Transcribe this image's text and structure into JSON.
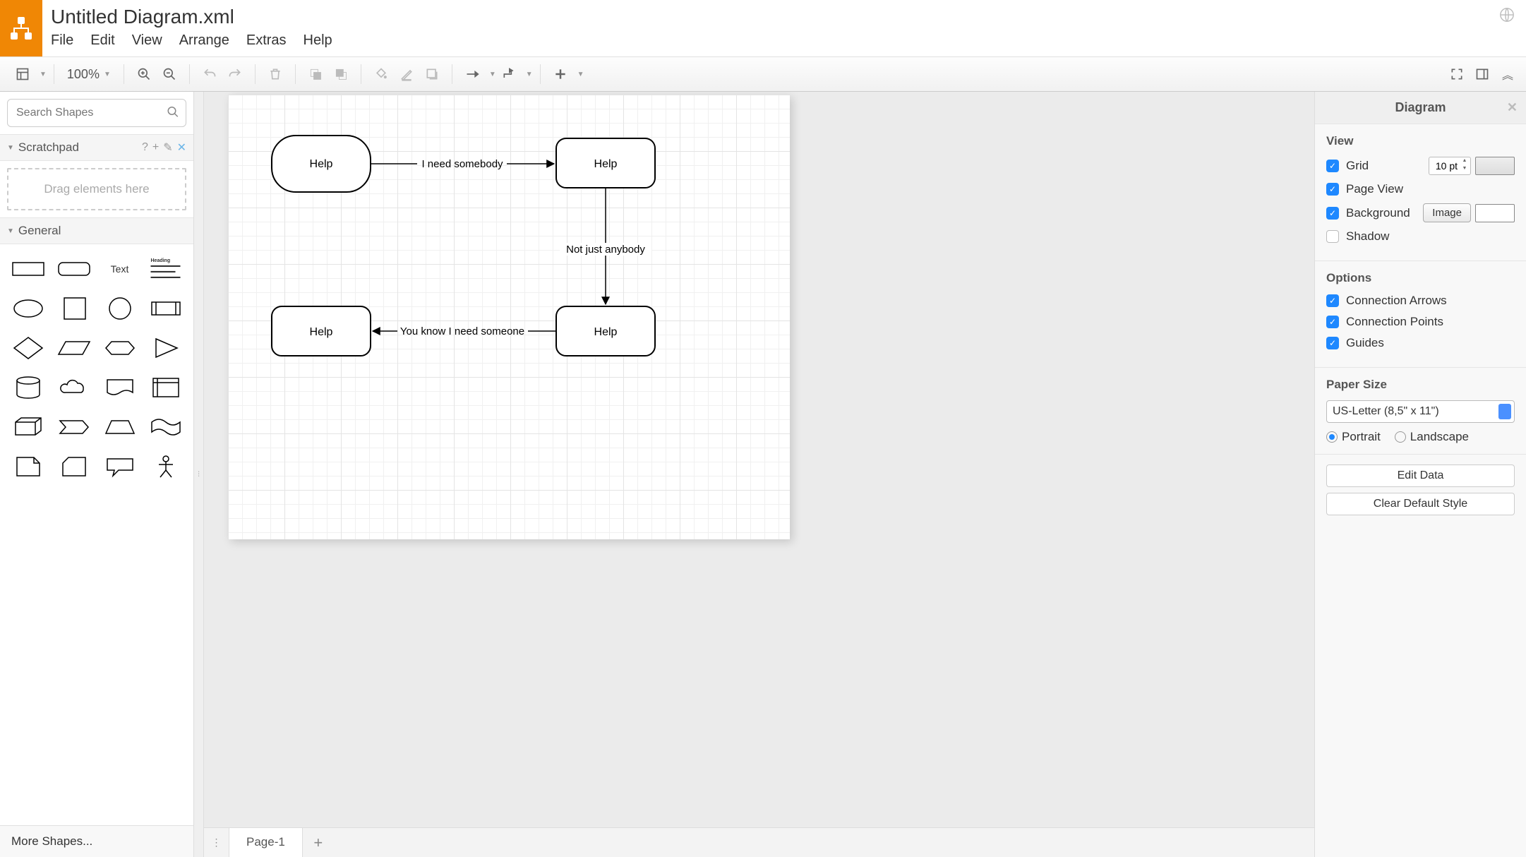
{
  "title": "Untitled Diagram.xml",
  "menubar": [
    "File",
    "Edit",
    "View",
    "Arrange",
    "Extras",
    "Help"
  ],
  "toolbar": {
    "zoom": "100%"
  },
  "sidebar": {
    "search_placeholder": "Search Shapes",
    "scratchpad": {
      "title": "Scratchpad",
      "hint": "Drag elements here"
    },
    "general": {
      "title": "General",
      "text_label": "Text",
      "heading_label": "Heading"
    },
    "more_shapes": "More Shapes..."
  },
  "tabs": {
    "page1": "Page-1"
  },
  "canvas": {
    "nodes": {
      "n1": "Help",
      "n2": "Help",
      "n3": "Help",
      "n4": "Help"
    },
    "edges": {
      "e1": "I need somebody",
      "e2": "Not just anybody",
      "e3": "You know I need someone"
    }
  },
  "panel": {
    "title": "Diagram",
    "view": {
      "heading": "View",
      "grid": "Grid",
      "grid_value": "10 pt",
      "page_view": "Page View",
      "background": "Background",
      "image_btn": "Image",
      "shadow": "Shadow"
    },
    "options": {
      "heading": "Options",
      "conn_arrows": "Connection Arrows",
      "conn_points": "Connection Points",
      "guides": "Guides"
    },
    "paper": {
      "heading": "Paper Size",
      "size": "US-Letter (8,5\" x 11\")",
      "portrait": "Portrait",
      "landscape": "Landscape"
    },
    "buttons": {
      "edit_data": "Edit Data",
      "clear_style": "Clear Default Style"
    }
  }
}
